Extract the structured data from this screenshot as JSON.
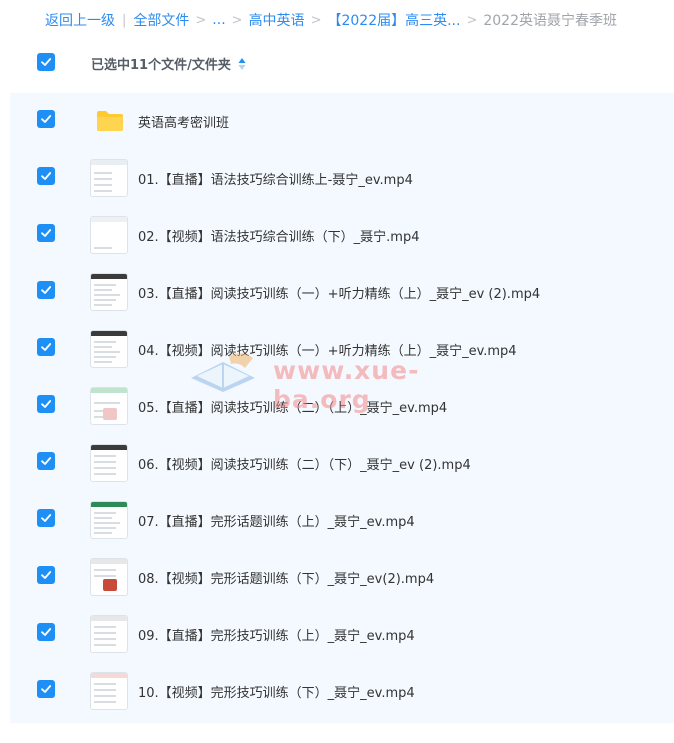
{
  "breadcrumb": {
    "back": "返回上一级",
    "all_files": "全部文件",
    "ellipsis": "...",
    "level1": "高中英语",
    "level2": "【2022届】高三英...",
    "current": "2022英语聂宁春季班"
  },
  "header": {
    "selected_label": "已选中11个文件/文件夹"
  },
  "watermark": "www.xue-ba.org",
  "colors": {
    "accent": "#1e90f5",
    "link": "#2d8cf0",
    "list_bg": "#f3f9fe",
    "folder": "#ffc933"
  },
  "items": [
    {
      "name": "英语高考密训班",
      "type": "folder"
    },
    {
      "name": "01.【直播】语法技巧综合训练上-聂宁_ev.mp4",
      "type": "video"
    },
    {
      "name": "02.【视频】语法技巧综合训练（下）_聂宁.mp4",
      "type": "video"
    },
    {
      "name": "03.【直播】阅读技巧训练（一）+听力精练（上）_聂宁_ev (2).mp4",
      "type": "video"
    },
    {
      "name": "04.【视频】阅读技巧训练（一）+听力精练（上）_聂宁_ev.mp4",
      "type": "video"
    },
    {
      "name": "05.【直播】阅读技巧训练（二）（上）_聂宁_ev.mp4",
      "type": "video"
    },
    {
      "name": "06.【视频】阅读技巧训练（二）（下）_聂宁_ev (2).mp4",
      "type": "video"
    },
    {
      "name": "07.【直播】完形话题训练（上）_聂宁_ev.mp4",
      "type": "video"
    },
    {
      "name": "08.【视频】完形话题训练（下）_聂宁_ev(2).mp4",
      "type": "video"
    },
    {
      "name": "09.【直播】完形技巧训练（上）_聂宁_ev.mp4",
      "type": "video"
    },
    {
      "name": "10.【视频】完形技巧训练（下）_聂宁_ev.mp4",
      "type": "video"
    }
  ]
}
